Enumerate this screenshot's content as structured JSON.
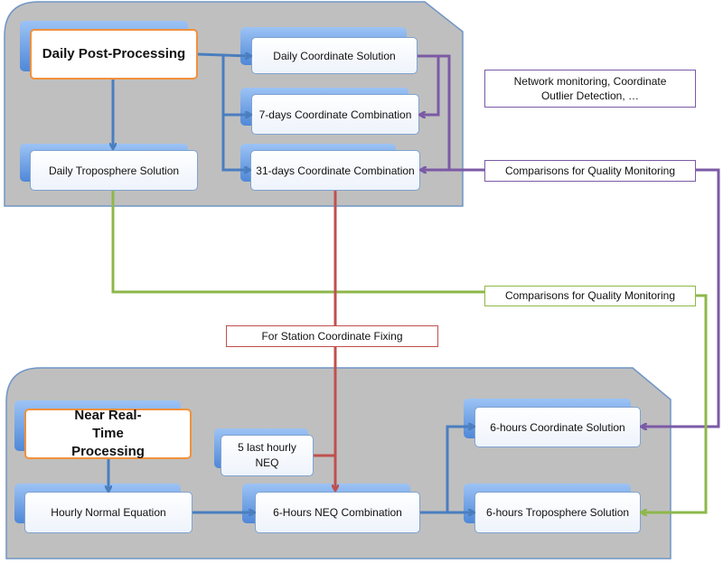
{
  "colors": {
    "panel": "#bfbfbf",
    "panel_border": "#6f95c6",
    "flow": "#4a7ebf",
    "quality_coordinate": "#7b5aa6",
    "quality_troposphere": "#8db84a",
    "fixing": "#c0504d",
    "main_border": "#f0913c"
  },
  "daily": {
    "title": "Daily Post-Processing",
    "coordinate_solution": "Daily Coordinate Solution",
    "combination_7": "7-days Coordinate Combination",
    "combination_31": "31-days Coordinate Combination",
    "troposphere": "Daily Troposphere Solution"
  },
  "notes": {
    "network": "Network monitoring, Coordinate Outlier Detection, …",
    "quality_coordinate": "Comparisons for Quality Monitoring",
    "quality_troposphere": "Comparisons for Quality Monitoring",
    "fixing": "For Station Coordinate Fixing"
  },
  "nrt": {
    "title": "Near Real-Time Processing",
    "hourly": "Hourly Normal Equation",
    "last5": "5 last hourly NEQ",
    "combination": "6-Hours NEQ Combination",
    "coordinate": "6-hours Coordinate Solution",
    "troposphere": "6-hours Troposphere Solution"
  }
}
